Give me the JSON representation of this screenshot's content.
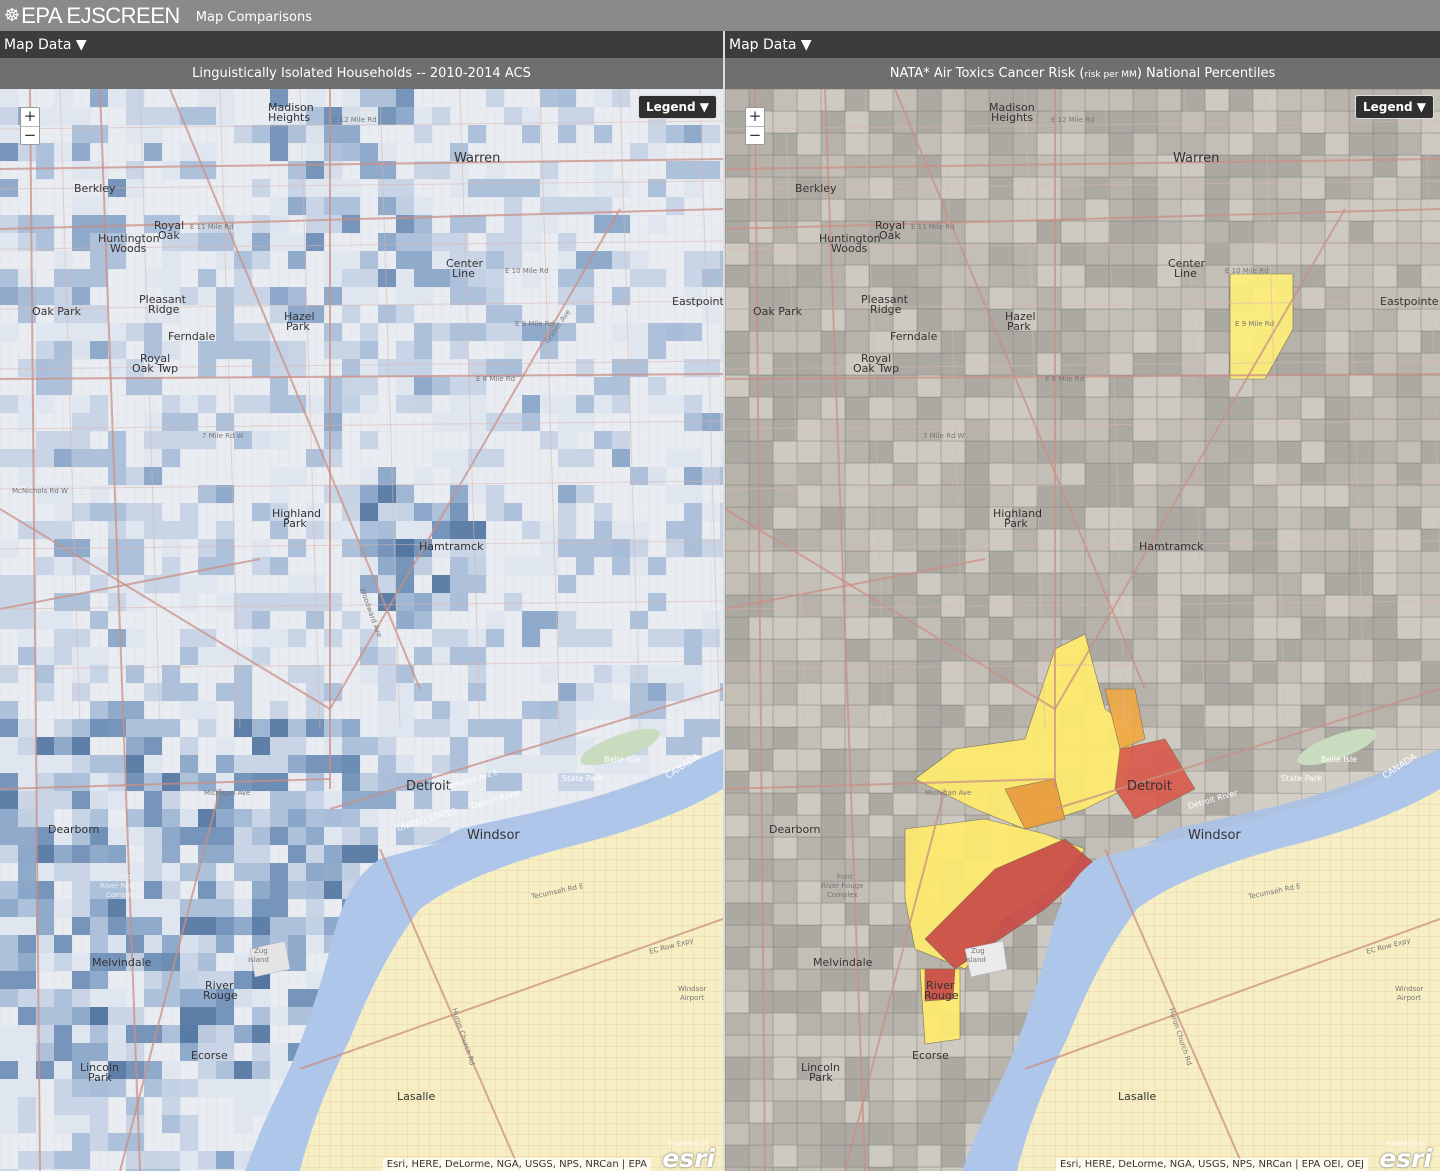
{
  "app": {
    "logo_mark": "☸",
    "logo": "EPA EJSCREEN",
    "subtitle": "Map Comparisons"
  },
  "left_panel": {
    "map_data_label": "Map Data ▼",
    "title": "Linguistically Isolated Households -- 2010-2014 ACS",
    "legend_label": "Legend ▼",
    "zoom_in": "+",
    "zoom_out": "−",
    "attribution": "Esri, HERE, DeLorme, NGA, USGS, NPS, NRCan | EPA",
    "esri_powered": "POWERED BY",
    "esri_logo": "esri"
  },
  "right_panel": {
    "map_data_label": "Map Data ▼",
    "title_main": "NATA* Air Toxics Cancer Risk (",
    "title_small": "risk per MM",
    "title_end": ") National Percentiles",
    "legend_label": "Legend ▼",
    "zoom_in": "+",
    "zoom_out": "−",
    "attribution": "Esri, HERE, DeLorme, NGA, USGS, NPS, NRCan | EPA OEI, OEJ",
    "esri_powered": "POWERED BY",
    "esri_logo": "esri"
  },
  "place_labels": {
    "madison": "Madison",
    "heights": "Heights",
    "warren": "Warren",
    "berkley": "Berkley",
    "royal_oak_1": "Royal",
    "royal_oak_2": "Oak",
    "huntington_1": "Huntington",
    "huntington_2": "Woods",
    "center_line_1": "Center",
    "center_line_2": "Line",
    "oak_park": "Oak Park",
    "pleasant_1": "Pleasant",
    "pleasant_2": "Ridge",
    "hazel_1": "Hazel",
    "hazel_2": "Park",
    "ferndale": "Ferndale",
    "royal_twp_1": "Royal",
    "royal_twp_2": "Oak Twp",
    "eastpointe": "Eastpointe",
    "highland_1": "Highland",
    "highland_2": "Park",
    "hamtramck": "Hamtramck",
    "detroit": "Detroit",
    "windsor": "Windsor",
    "dearborn": "Dearborn",
    "melvindale": "Melvindale",
    "river_1": "River",
    "river_2": "Rouge",
    "ecorse": "Ecorse",
    "lincoln_1": "Lincoln",
    "lincoln_2": "Park",
    "lasalle": "Lasalle",
    "canada": "CANADA",
    "united_states": "UNITED STATES",
    "detroit_river": "Detroit River",
    "belle_isle_1": "Belle Isle",
    "belle_isle_2": "State Park",
    "windsor_airport_1": "Windsor",
    "windsor_airport_2": "Airport",
    "ford_1": "Ford",
    "ford_2": "River Rouge",
    "ford_3": "Complex",
    "zug_1": "Zug",
    "zug_2": "Island",
    "e12": "E 12 Mile Rd",
    "e11": "E 11 Mile Rd",
    "e10": "E 10 Mile Rd",
    "e9": "E 9 Mile Rd",
    "e8": "E 8 Mile Rd",
    "seven": "7 Mile Rd W",
    "mcnichols": "McNichols Rd W",
    "jefferson": "Jefferson Ave E",
    "gratiot": "Gratiot Ave",
    "woodward": "Woodward Ave",
    "michigan": "Michigan Ave",
    "ec_row": "EC Row Expy",
    "tecumseh": "Tecumseh Rd E",
    "huron_church": "Huron Church Rd"
  }
}
